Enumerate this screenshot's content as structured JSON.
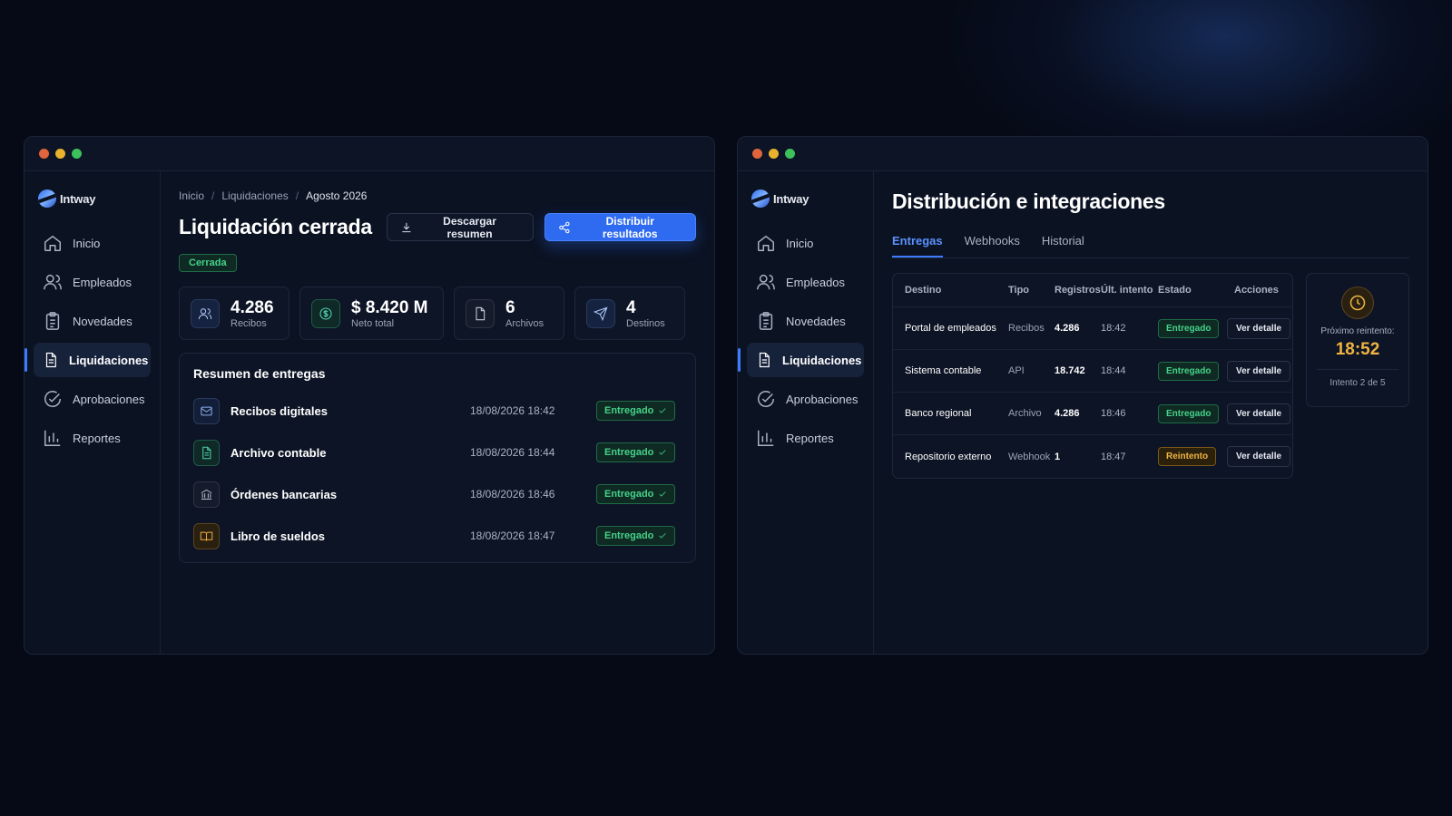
{
  "brand": {
    "name": "Intway"
  },
  "nav": {
    "items": [
      {
        "label": "Inicio",
        "icon": "home-icon"
      },
      {
        "label": "Empleados",
        "icon": "users-icon"
      },
      {
        "label": "Novedades",
        "icon": "clipboard-icon"
      },
      {
        "label": "Liquidaciones",
        "icon": "document-icon",
        "active": true
      },
      {
        "label": "Aprobaciones",
        "icon": "check-circle-icon"
      },
      {
        "label": "Reportes",
        "icon": "bar-chart-icon"
      }
    ]
  },
  "left": {
    "breadcrumb": [
      "Inicio",
      "Liquidaciones",
      "Agosto 2026"
    ],
    "title": "Liquidación cerrada",
    "download_label": "Descargar resumen",
    "distribute_label": "Distribuir resultados",
    "status_badge": "Cerrada",
    "stats": [
      {
        "value": "4.286",
        "label": "Recibos",
        "icon": "users-icon"
      },
      {
        "value": "$ 8.420 M",
        "label": "Neto total",
        "icon": "dollar-icon"
      },
      {
        "value": "6",
        "label": "Archivos",
        "icon": "file-icon"
      },
      {
        "value": "4",
        "label": "Destinos",
        "icon": "send-icon"
      }
    ],
    "deliveries_title": "Resumen de entregas",
    "deliveries": [
      {
        "name": "Recibos digitales",
        "time": "18/08/2026 18:42",
        "status": "Entregado",
        "icon": "mail-icon"
      },
      {
        "name": "Archivo contable",
        "time": "18/08/2026 18:44",
        "status": "Entregado",
        "icon": "file-text-icon"
      },
      {
        "name": "Órdenes bancarias",
        "time": "18/08/2026 18:46",
        "status": "Entregado",
        "icon": "bank-icon"
      },
      {
        "name": "Libro de sueldos",
        "time": "18/08/2026 18:47",
        "status": "Entregado",
        "icon": "book-icon"
      }
    ]
  },
  "right": {
    "title": "Distribución e integraciones",
    "tabs": [
      "Entregas",
      "Webhooks",
      "Historial"
    ],
    "table_headers": [
      "Destino",
      "Tipo",
      "Registros",
      "Últ. intento",
      "Estado",
      "Acciones"
    ],
    "rows": [
      {
        "destino": "Portal de empleados",
        "tipo": "Recibos",
        "registros": "4.286",
        "intento": "18:42",
        "estado": "Entregado",
        "accion": "Ver detalle"
      },
      {
        "destino": "Sistema contable",
        "tipo": "API",
        "registros": "18.742",
        "intento": "18:44",
        "estado": "Entregado",
        "accion": "Ver detalle"
      },
      {
        "destino": "Banco regional",
        "tipo": "Archivo",
        "registros": "4.286",
        "intento": "18:46",
        "estado": "Entregado",
        "accion": "Ver detalle"
      },
      {
        "destino": "Repositorio externo",
        "tipo": "Webhook",
        "registros": "1",
        "intento": "18:47",
        "estado": "Reintento",
        "accion": "Ver detalle"
      }
    ],
    "retry": {
      "label": "Próximo reintento:",
      "time": "18:52",
      "attempt": "Intento 2 de 5"
    }
  },
  "colors": {
    "accent": "#2f6bf0",
    "success": "#45d28a",
    "warning": "#f0b440",
    "background": "#060a16"
  }
}
